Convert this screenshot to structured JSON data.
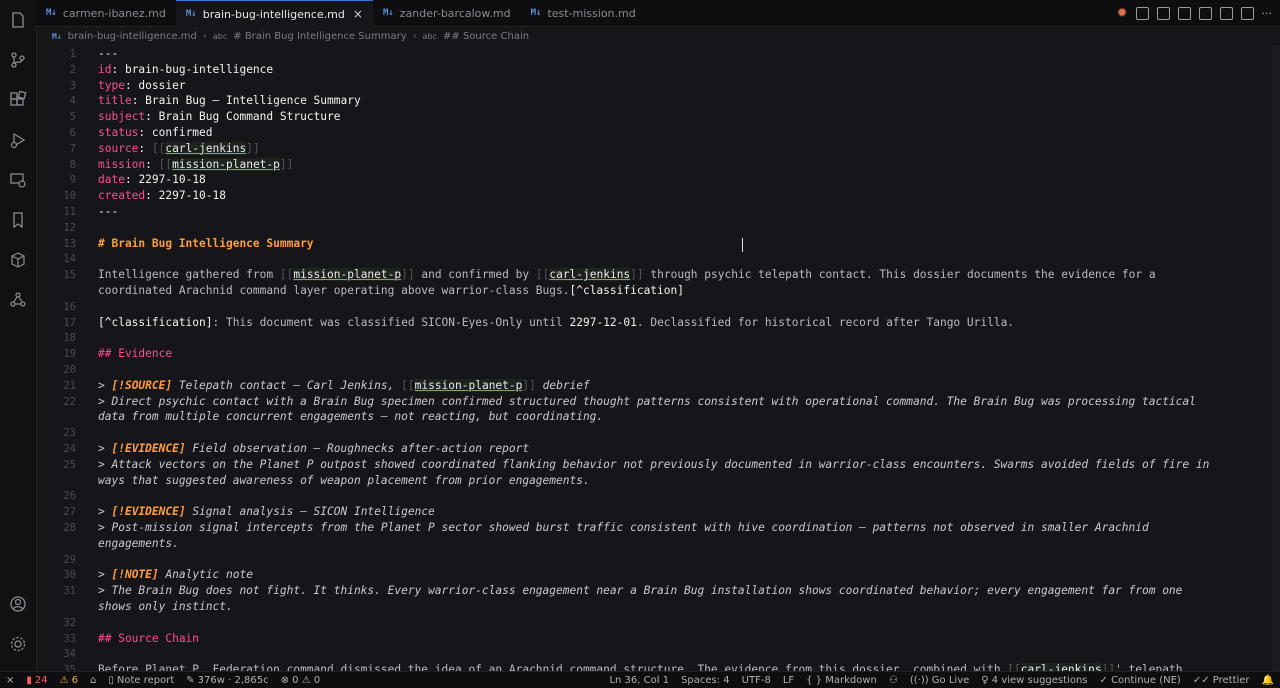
{
  "tabs": [
    {
      "label": "carmen-ibanez.md",
      "active": false
    },
    {
      "label": "brain-bug-intelligence.md",
      "active": true
    },
    {
      "label": "zander-barcalow.md",
      "active": false
    },
    {
      "label": "test-mission.md",
      "active": false
    }
  ],
  "tab_close": "×",
  "md_badge": "M↓",
  "breadcrumb": {
    "file": "brain-bug-intelligence.md",
    "section1": "# Brain Bug Intelligence Summary",
    "section2": "## Source Chain"
  },
  "lines": [
    {
      "n": "1",
      "segs": [
        {
          "c": "v",
          "t": "---"
        }
      ]
    },
    {
      "n": "2",
      "segs": [
        {
          "c": "k",
          "t": "id"
        },
        {
          "c": "v",
          "t": ": brain-bug-intelligence"
        }
      ]
    },
    {
      "n": "3",
      "segs": [
        {
          "c": "k",
          "t": "type"
        },
        {
          "c": "v",
          "t": ": dossier"
        }
      ]
    },
    {
      "n": "4",
      "segs": [
        {
          "c": "k",
          "t": "title"
        },
        {
          "c": "v",
          "t": ": Brain Bug — Intelligence Summary"
        }
      ]
    },
    {
      "n": "5",
      "segs": [
        {
          "c": "k",
          "t": "subject"
        },
        {
          "c": "v",
          "t": ": Brain Bug Command Structure"
        }
      ]
    },
    {
      "n": "6",
      "segs": [
        {
          "c": "k",
          "t": "status"
        },
        {
          "c": "v",
          "t": ": confirmed"
        }
      ]
    },
    {
      "n": "7",
      "segs": [
        {
          "c": "k",
          "t": "source"
        },
        {
          "c": "v",
          "t": ": "
        },
        {
          "c": "br",
          "t": "[["
        },
        {
          "c": "link",
          "t": "carl-jenkins"
        },
        {
          "c": "br",
          "t": "]]"
        }
      ]
    },
    {
      "n": "8",
      "segs": [
        {
          "c": "k",
          "t": "mission"
        },
        {
          "c": "v",
          "t": ": "
        },
        {
          "c": "br",
          "t": "[["
        },
        {
          "c": "link",
          "t": "mission-planet-p"
        },
        {
          "c": "br",
          "t": "]]"
        }
      ]
    },
    {
      "n": "9",
      "segs": [
        {
          "c": "k",
          "t": "date"
        },
        {
          "c": "v",
          "t": ": "
        },
        {
          "c": "dn",
          "t": "2297-10-18"
        }
      ]
    },
    {
      "n": "10",
      "segs": [
        {
          "c": "k",
          "t": "created"
        },
        {
          "c": "v",
          "t": ": "
        },
        {
          "c": "dn",
          "t": "2297-10-18"
        }
      ]
    },
    {
      "n": "11",
      "segs": [
        {
          "c": "v",
          "t": "---"
        }
      ]
    },
    {
      "n": "12",
      "segs": []
    },
    {
      "n": "13",
      "segs": [
        {
          "c": "h",
          "t": "# Brain Bug Intelligence Summary"
        }
      ]
    },
    {
      "n": "14",
      "segs": []
    },
    {
      "n": "15",
      "segs": [
        {
          "c": "t",
          "t": "Intelligence gathered from "
        },
        {
          "c": "br",
          "t": "[["
        },
        {
          "c": "link",
          "t": "mission-planet-p"
        },
        {
          "c": "br",
          "t": "]]"
        },
        {
          "c": "t",
          "t": " and confirmed by "
        },
        {
          "c": "br",
          "t": "[["
        },
        {
          "c": "link",
          "t": "carl-jenkins"
        },
        {
          "c": "br",
          "t": "]]"
        },
        {
          "c": "t",
          "t": " through psychic telepath contact. This dossier documents the evidence for a"
        }
      ]
    },
    {
      "n": "",
      "segs": [
        {
          "c": "t",
          "t": "coordinated Arachnid command layer operating above warrior-class Bugs."
        },
        {
          "c": "fn",
          "t": "[^classification]"
        }
      ]
    },
    {
      "n": "16",
      "segs": []
    },
    {
      "n": "17",
      "segs": [
        {
          "c": "fn",
          "t": "[^classification]"
        },
        {
          "c": "t",
          "t": ": This document was classified SICON-Eyes-Only until "
        },
        {
          "c": "dn",
          "t": "2297-12-01"
        },
        {
          "c": "t",
          "t": ". Declassified for historical record after Tango Urilla."
        }
      ]
    },
    {
      "n": "18",
      "segs": []
    },
    {
      "n": "19",
      "segs": [
        {
          "c": "k",
          "t": "## Evidence"
        }
      ]
    },
    {
      "n": "20",
      "segs": []
    },
    {
      "n": "21",
      "segs": [
        {
          "c": "q",
          "t": "> "
        },
        {
          "c": "tag",
          "t": "[!SOURCE]"
        },
        {
          "c": "q",
          "t": " Telepath contact — Carl Jenkins, "
        },
        {
          "c": "br",
          "t": "[["
        },
        {
          "c": "link",
          "t": "mission-planet-p"
        },
        {
          "c": "br",
          "t": "]]"
        },
        {
          "c": "q",
          "t": " debrief"
        }
      ]
    },
    {
      "n": "22",
      "segs": [
        {
          "c": "q",
          "t": "> Direct psychic contact with a Brain Bug specimen confirmed structured thought patterns consistent with operational command. The Brain Bug was processing tactical"
        }
      ]
    },
    {
      "n": "",
      "segs": [
        {
          "c": "q",
          "t": "data from multiple concurrent engagements — not reacting, but coordinating."
        }
      ]
    },
    {
      "n": "23",
      "segs": []
    },
    {
      "n": "24",
      "segs": [
        {
          "c": "q",
          "t": "> "
        },
        {
          "c": "tag",
          "t": "[!EVIDENCE]"
        },
        {
          "c": "q",
          "t": " Field observation — Roughnecks after-action report"
        }
      ]
    },
    {
      "n": "25",
      "segs": [
        {
          "c": "q",
          "t": "> Attack vectors on the Planet P outpost showed coordinated flanking behavior not previously documented in warrior-class encounters. Swarms avoided fields of fire in"
        }
      ]
    },
    {
      "n": "",
      "segs": [
        {
          "c": "q",
          "t": "ways that suggested awareness of weapon placement from prior engagements."
        }
      ]
    },
    {
      "n": "26",
      "segs": []
    },
    {
      "n": "27",
      "segs": [
        {
          "c": "q",
          "t": "> "
        },
        {
          "c": "tag",
          "t": "[!EVIDENCE]"
        },
        {
          "c": "q",
          "t": " Signal analysis — SICON Intelligence"
        }
      ]
    },
    {
      "n": "28",
      "segs": [
        {
          "c": "q",
          "t": "> Post-mission signal intercepts from the Planet P sector showed burst traffic consistent with hive coordination — patterns not observed in smaller Arachnid"
        }
      ]
    },
    {
      "n": "",
      "segs": [
        {
          "c": "q",
          "t": "engagements."
        }
      ]
    },
    {
      "n": "29",
      "segs": []
    },
    {
      "n": "30",
      "segs": [
        {
          "c": "q",
          "t": "> "
        },
        {
          "c": "tag",
          "t": "[!NOTE]"
        },
        {
          "c": "q",
          "t": " Analytic note"
        }
      ]
    },
    {
      "n": "31",
      "segs": [
        {
          "c": "q",
          "t": "> The Brain Bug does not fight. It thinks. Every warrior-class engagement near a Brain Bug installation shows coordinated behavior; every engagement far from one"
        }
      ]
    },
    {
      "n": "",
      "segs": [
        {
          "c": "q",
          "t": "shows only instinct."
        }
      ]
    },
    {
      "n": "32",
      "segs": []
    },
    {
      "n": "33",
      "segs": [
        {
          "c": "k",
          "t": "## Source Chain"
        }
      ]
    },
    {
      "n": "34",
      "segs": []
    },
    {
      "n": "35",
      "segs": [
        {
          "c": "t",
          "t": "Before Planet P, Federation command dismissed the idea of an Arachnid command structure. The evidence from this dossier, combined with "
        },
        {
          "c": "br",
          "t": "[["
        },
        {
          "c": "link",
          "t": "carl-jenkins"
        },
        {
          "c": "br",
          "t": "]]"
        },
        {
          "c": "t",
          "t": "' telepath"
        }
      ]
    }
  ],
  "status": {
    "left_items": [
      {
        "name": "remote-status",
        "text": "⨯"
      },
      {
        "name": "error-count",
        "text": "24",
        "cls": "err",
        "icon": "▮"
      },
      {
        "name": "warning-count",
        "text": "6",
        "cls": "warn",
        "icon": "⚠"
      },
      {
        "name": "home-status",
        "text": "⌂"
      },
      {
        "name": "note-report",
        "text": "Note report",
        "icon": "▯"
      },
      {
        "name": "word-count",
        "text": "376w · 2,865c",
        "icon": "✎"
      },
      {
        "name": "problems-count",
        "text": "⊗ 0 ⚠ 0"
      }
    ],
    "right_items": [
      {
        "name": "cursor-position",
        "text": "Ln 36, Col 1"
      },
      {
        "name": "indentation",
        "text": "Spaces: 4"
      },
      {
        "name": "encoding",
        "text": "UTF-8"
      },
      {
        "name": "line-ending",
        "text": "LF"
      },
      {
        "name": "language-mode",
        "text": "{ } Markdown"
      },
      {
        "name": "copilot-status",
        "text": "⚇"
      },
      {
        "name": "go-live",
        "text": "((·)) Go Live"
      },
      {
        "name": "view-suggestions",
        "text": "♀ 4 view suggestions"
      },
      {
        "name": "continue-status",
        "text": "✓ Continue (NE)"
      },
      {
        "name": "prettier-status",
        "text": "✓✓ Prettier"
      },
      {
        "name": "notifications",
        "text": "🔔"
      }
    ]
  },
  "colors": {
    "accent": "#3a7bd5",
    "keyword": "#ff4d8f",
    "heading": "#ff9d3b"
  }
}
